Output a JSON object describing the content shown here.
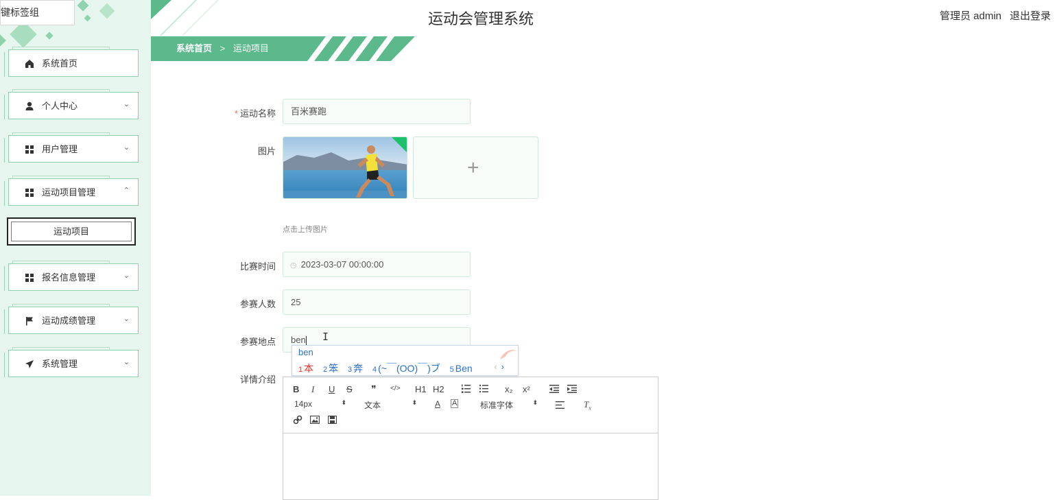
{
  "tooltip": {
    "text": "键标签组"
  },
  "header": {
    "title": "运动会管理系统",
    "admin": "管理员 admin",
    "logout": "退出登录"
  },
  "breadcrumb": {
    "home": "系统首页",
    "sep": ">",
    "current": "运动项目"
  },
  "sidebar": {
    "items": [
      {
        "label": "系统首页",
        "icon": "home-icon",
        "arrow": ""
      },
      {
        "label": "个人中心",
        "icon": "user-icon",
        "arrow": "⌄"
      },
      {
        "label": "用户管理",
        "icon": "grid-icon",
        "arrow": "⌄"
      },
      {
        "label": "运动项目管理",
        "icon": "grid-icon",
        "arrow": "⌃"
      },
      {
        "label": "报名信息管理",
        "icon": "grid-icon",
        "arrow": "⌄"
      },
      {
        "label": "运动成绩管理",
        "icon": "flag-icon",
        "arrow": "⌄"
      },
      {
        "label": "系统管理",
        "icon": "send-icon",
        "arrow": "⌄"
      }
    ],
    "sub_item": "运动项目"
  },
  "form": {
    "name_label": "运动名称",
    "name_value": "百米赛跑",
    "image_label": "图片",
    "upload_hint": "点击上传图片",
    "time_label": "比赛时间",
    "time_value": "2023-03-07 00:00:00",
    "count_label": "参赛人数",
    "count_value": "25",
    "place_label": "参赛地点",
    "place_value": "ben",
    "detail_label": "详情介绍"
  },
  "ime": {
    "input": "ben",
    "candidates": [
      {
        "n": "1",
        "text": "本"
      },
      {
        "n": "2",
        "text": "笨"
      },
      {
        "n": "3",
        "text": "奔"
      },
      {
        "n": "4",
        "text": "(~￣(OO)￣)ブ"
      },
      {
        "n": "5",
        "text": "Ben"
      }
    ],
    "prev": "‹",
    "next": "›"
  },
  "editor": {
    "font_size": "14px",
    "text_type": "文本",
    "font_family": "标准字体",
    "buttons": [
      "B",
      "I",
      "U",
      "S",
      "❞",
      "</>",
      "H1",
      "H2",
      "ol",
      "ul",
      "x₂",
      "x²",
      "outdent",
      "indent"
    ]
  },
  "colors": {
    "accent": "#5bb98b",
    "sidebar_bg": "#e6f6ee",
    "ime_blue": "#2a6fc9",
    "required": "#f56c6c"
  }
}
